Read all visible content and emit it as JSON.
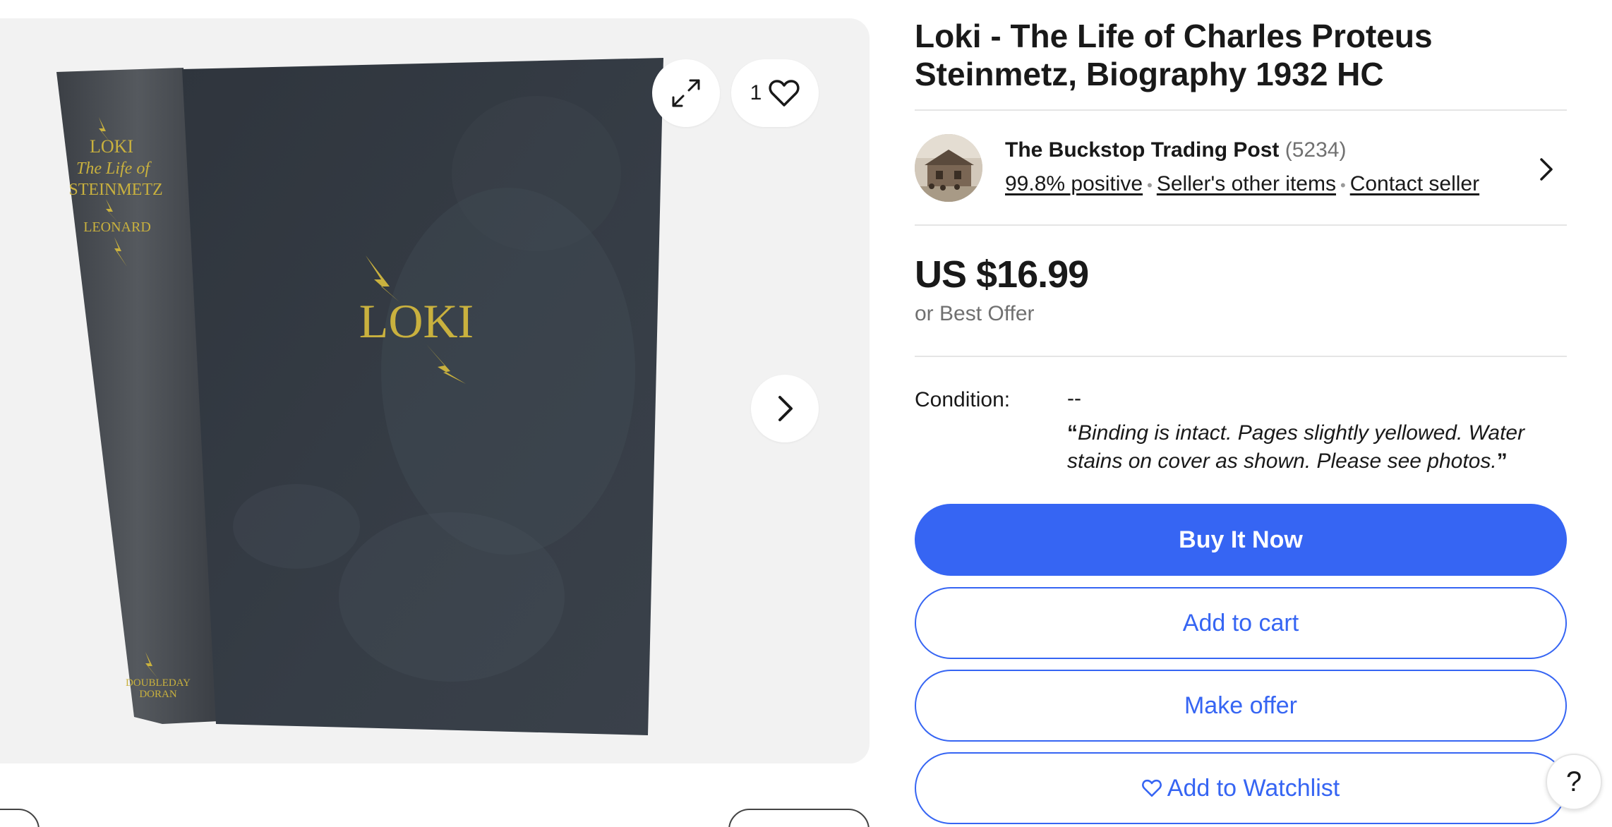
{
  "gallery": {
    "favorite_count": "1",
    "image_alt": "Book cover",
    "book_spine": {
      "line1": "LOKI",
      "line2": "The Life of",
      "line3": "STEINMETZ",
      "author": "LEONARD",
      "publisher_line1": "DOUBLEDAY",
      "publisher_line2": "DORAN"
    },
    "book_cover_title": "LOKI",
    "icons": {
      "expand": "expand-icon",
      "favorite": "heart-icon",
      "next": "chevron-right-icon"
    }
  },
  "listing": {
    "title": "Loki - The Life of Charles Proteus Steinmetz, Biography 1932 HC",
    "price": "US $16.99",
    "best_offer": "or Best Offer"
  },
  "seller": {
    "name": "The Buckstop Trading Post",
    "feedback_count": "(5234)",
    "positive": "99.8% positive",
    "other_items": "Seller's other items",
    "contact": "Contact seller"
  },
  "condition": {
    "label": "Condition:",
    "value": "--",
    "open_quote": "“",
    "description": "Binding is intact. Pages slightly yellowed. Water stains on cover as shown. Please see photos.",
    "close_quote": "”"
  },
  "buttons": {
    "buy_now": "Buy It Now",
    "add_to_cart": "Add to cart",
    "make_offer": "Make offer",
    "add_to_watchlist": "Add to Watchlist"
  },
  "help": "?",
  "colors": {
    "accent": "#3665f3",
    "text": "#191919",
    "muted": "#707070",
    "gallery_bg": "#f2f2f2",
    "book_cover": "#333a42",
    "book_gold": "#c9b13e"
  }
}
